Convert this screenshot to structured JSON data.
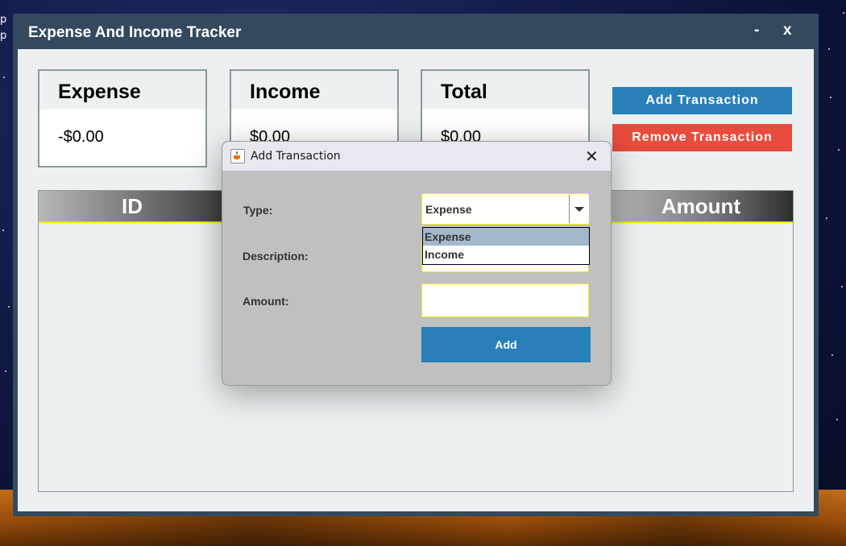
{
  "desktop": {
    "label_line1": "p",
    "label_line2": "p"
  },
  "app": {
    "title": "Expense And Income Tracker",
    "minimize_label": "-",
    "close_label": "x"
  },
  "cards": [
    {
      "title": "Expense",
      "value": "-$0.00"
    },
    {
      "title": "Income",
      "value": "$0.00"
    },
    {
      "title": "Total",
      "value": "$0.00"
    }
  ],
  "actions": {
    "add_label": "Add Transaction",
    "remove_label": "Remove Transaction"
  },
  "table": {
    "columns": [
      "ID",
      "",
      "Amount"
    ]
  },
  "dialog": {
    "title": "Add Transaction",
    "close_symbol": "✕",
    "type_label": "Type:",
    "description_label": "Description:",
    "amount_label": "Amount:",
    "type_selected": "Expense",
    "type_options": [
      "Expense",
      "Income"
    ],
    "highlighted_option": "Expense",
    "description_value": "",
    "amount_value": "",
    "submit_label": "Add"
  },
  "colors": {
    "window_frame": "#34495e",
    "content_bg": "#ecf0f1",
    "primary_button": "#2980b9",
    "danger_button": "#e74c3c",
    "input_border": "#f1e814",
    "dialog_bg": "#c0c0c0",
    "dropdown_highlight": "#a3b8cc"
  }
}
